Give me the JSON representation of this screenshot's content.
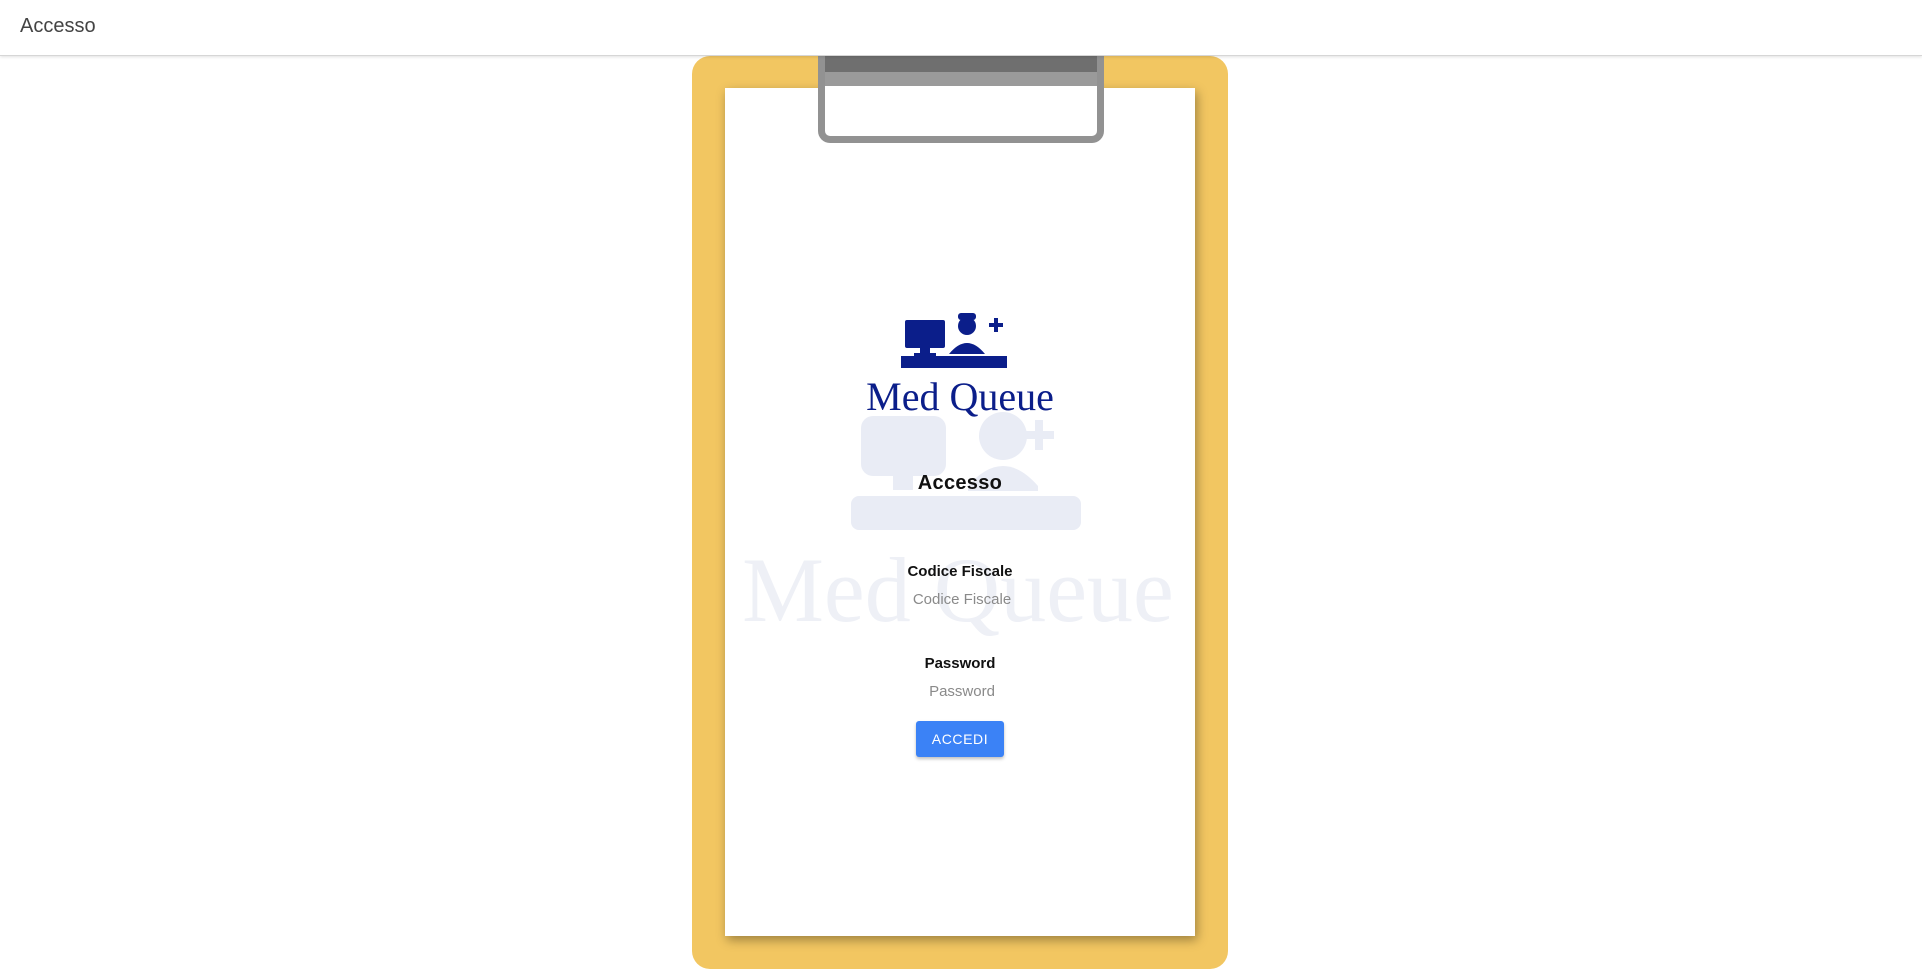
{
  "header": {
    "title": "Accesso"
  },
  "brand": {
    "name": "Med Queue",
    "color": "#0b1e8a",
    "watermark_color": "#e9ecf5",
    "logo_icon": "nurse-desk-computer-icon"
  },
  "clipboard": {
    "board_color": "#f2c661",
    "clip_color": "#929292"
  },
  "form": {
    "title": "Accesso",
    "fields": [
      {
        "label": "Codice Fiscale",
        "placeholder": "Codice Fiscale",
        "value": ""
      },
      {
        "label": "Password",
        "placeholder": "Password",
        "value": ""
      }
    ],
    "submit_label": "ACCEDI",
    "submit_color": "#3b82f6"
  }
}
